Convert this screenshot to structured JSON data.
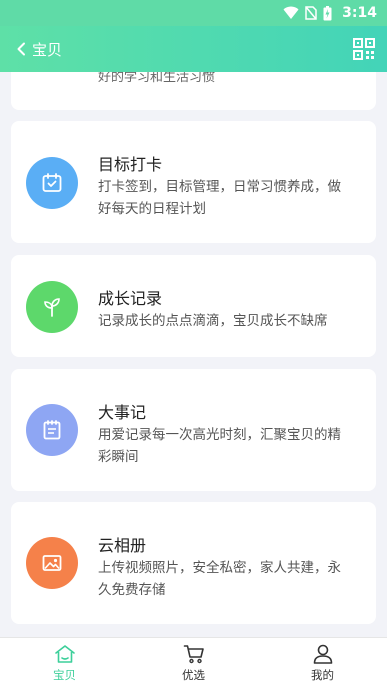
{
  "status_bar": {
    "time": "3:14"
  },
  "header": {
    "back_label": "宝贝"
  },
  "partial_card": {
    "desc": "好的学习和生活习惯"
  },
  "cards": [
    {
      "title": "目标打卡",
      "desc": "打卡签到，目标管理，日常习惯养成，做好每天的日程计划",
      "icon": "calendar-check-icon",
      "color": "#5aaef5"
    },
    {
      "title": "成长记录",
      "desc": "记录成长的点点滴滴，宝贝成长不缺席",
      "icon": "sprout-icon",
      "color": "#5dd86b"
    },
    {
      "title": "大事记",
      "desc": "用爱记录每一次高光时刻，汇聚宝贝的精彩瞬间",
      "icon": "notebook-icon",
      "color": "#8ea6f3"
    },
    {
      "title": "云相册",
      "desc": "上传视频照片，安全私密，家人共建，永久免费存储",
      "icon": "photo-icon",
      "color": "#f5814a"
    }
  ],
  "tabbar": {
    "items": [
      {
        "label": "宝贝",
        "active": true
      },
      {
        "label": "优选",
        "active": false
      },
      {
        "label": "我的",
        "active": false
      }
    ],
    "active_color": "#3ccf9a"
  }
}
